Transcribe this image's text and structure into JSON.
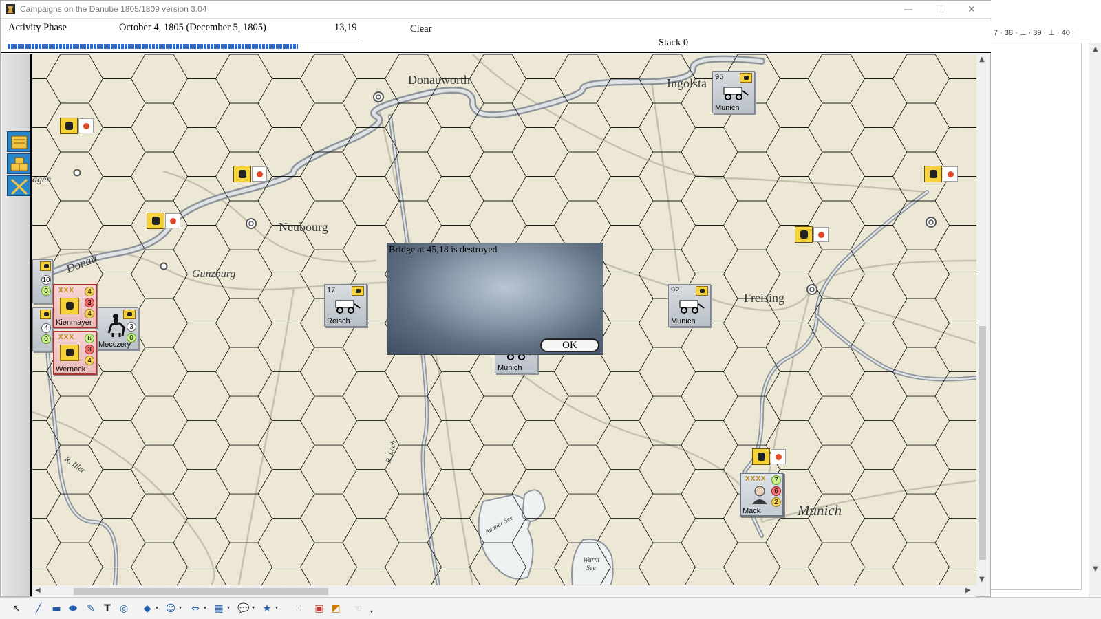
{
  "window": {
    "title": "Campaigns on the Danube 1805/1809  version 3.04",
    "minimize_glyph": "—",
    "maximize_glyph": "☐",
    "close_glyph": "✕"
  },
  "status": {
    "phase": "Activity Phase",
    "date": "October 4, 1805 (December 5, 1805)",
    "coords": "13,19",
    "weather": "Clear",
    "stack": "Stack 0",
    "progress_fraction": 0.82
  },
  "map": {
    "places": [
      "Donauworth",
      "Ingolstadt",
      "Neubourg",
      "Gunzburg",
      "Freising",
      "Munich",
      "Donau",
      "R. Iller",
      "R. Lech",
      "Ammer See",
      "Wurm See",
      "agen"
    ],
    "places_display": {
      "donauworth": "Donauworth",
      "ingolstadt": "Ingolsta",
      "neubourg": "Neubourg",
      "gunzburg": "Gunzburg",
      "freising": "Freising",
      "munich": "Munich",
      "donau": "Donau",
      "iller": "R. Iller",
      "lech": "R. Lech",
      "ammer": "Ammer See",
      "wurm1": "Wurm",
      "wurm2": "See",
      "agen": "agen"
    }
  },
  "units": {
    "supply_ingolstadt": {
      "number": "95",
      "label": "Munich"
    },
    "supply_reisch": {
      "number": "17",
      "label": "Reisch"
    },
    "supply_freising": {
      "number": "92",
      "label": "Munich"
    },
    "supply_center": {
      "label": "Munich"
    },
    "leader_kienmayer": {
      "name": "Kienmayer",
      "rank": "XXX",
      "values": [
        "4",
        "3",
        "4"
      ]
    },
    "leader_werneck": {
      "name": "Werneck",
      "rank": "XXX",
      "values": [
        "6",
        "3",
        "4"
      ]
    },
    "leader_mack": {
      "name": "Mack",
      "rank": "XXXX",
      "values": [
        "7",
        "6",
        "2"
      ]
    },
    "cavalry_mecczery": {
      "name": "Mecczery",
      "values": [
        "3",
        "0"
      ]
    },
    "stack_left_top": {
      "values": [
        "10",
        "0"
      ]
    },
    "stack_left_bottom": {
      "values": [
        "4",
        "0"
      ]
    }
  },
  "dialog": {
    "message": "Bridge at 45,18 is destroyed",
    "ok_label": "OK"
  },
  "right_doc": {
    "ruler_text": "7 · 38 · ⊥ · 39 · ⊥ · 40 ·"
  },
  "colors": {
    "progress": "#2d6bd4",
    "map_bg": "#ede8d6",
    "river": "#8e959a",
    "hex_line": "#1a1a1a",
    "palette_button": "#2a86c9"
  }
}
